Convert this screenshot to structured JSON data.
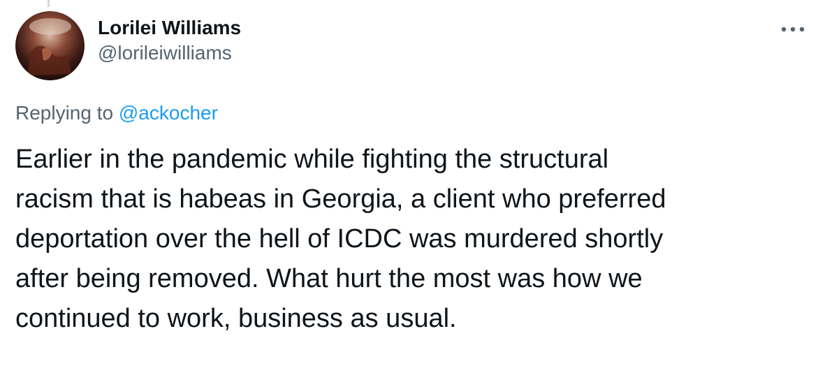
{
  "tweet": {
    "author": {
      "display_name": "Lorilei Williams",
      "handle": "@lorileiwilliams",
      "avatar_icon": "user-avatar"
    },
    "more_icon": "ellipsis-icon",
    "replying": {
      "prefix": "Replying to",
      "mention": "@ackocher"
    },
    "text_lines": [
      "Earlier in the pandemic while fighting the structural",
      "racism that is habeas in Georgia, a client who preferred",
      "deportation over the hell of ICDC was murdered shortly",
      "after being removed. What hurt the most was how we",
      "continued to work, business as usual."
    ],
    "colors": {
      "primary_text": "#0f1419",
      "secondary_text": "#536471",
      "link": "#1d9bf0"
    }
  }
}
